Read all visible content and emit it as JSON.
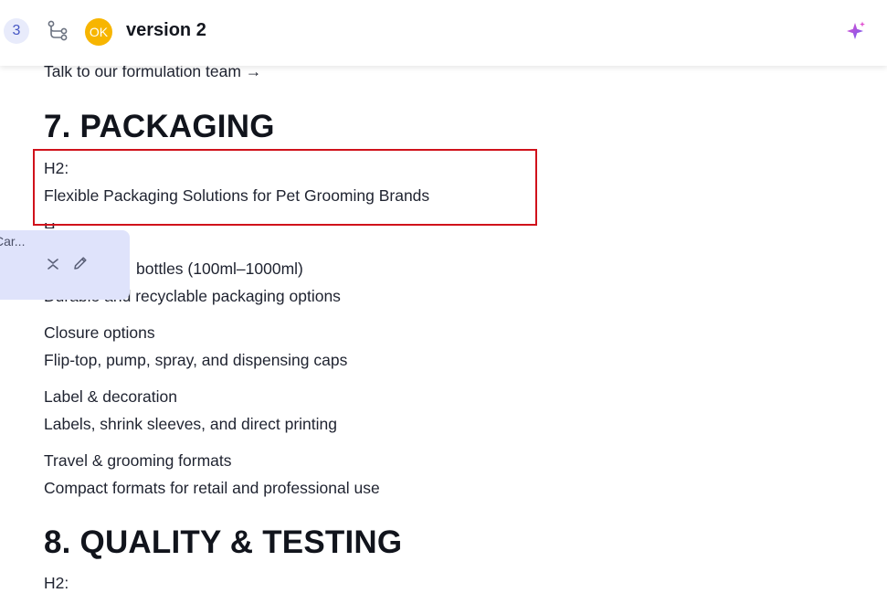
{
  "toolbar": {
    "comment_count": "3",
    "avatar_initials": "OK",
    "avatar_color": "#f7b500",
    "version_title": "version 2",
    "icons": [
      "branch-icon",
      "sparkle-icon"
    ]
  },
  "comment": {
    "preview": "Car...",
    "icons": [
      "collapse-icon",
      "edit-icon"
    ]
  },
  "document": {
    "cta": "Talk to our formulation team →",
    "section7": {
      "heading": "7. PACKAGING",
      "h2_label": "H2:",
      "h2_text": "Flexible Packaging Solutions for Pet Grooming Brands",
      "partial_line": "H",
      "item1_title_visible": "bottles (100ml–1000ml)",
      "item1_title_hidden_fragment": "…",
      "item1_desc": "Durable and recyclable packaging options",
      "item2_title": "Closure options",
      "item2_desc": "Flip-top, pump, spray, and dispensing caps",
      "item3_title": "Label & decoration",
      "item3_desc": "Labels, shrink sleeves, and direct printing",
      "item4_title": "Travel & grooming formats",
      "item4_desc": "Compact formats for retail and professional use"
    },
    "section8": {
      "heading": "8. QUALITY & TESTING",
      "h2_label": "H2:"
    }
  },
  "colors": {
    "highlight_border": "#d0121b",
    "comment_card_bg": "#dfe3fb",
    "accent": "#4657c4"
  }
}
